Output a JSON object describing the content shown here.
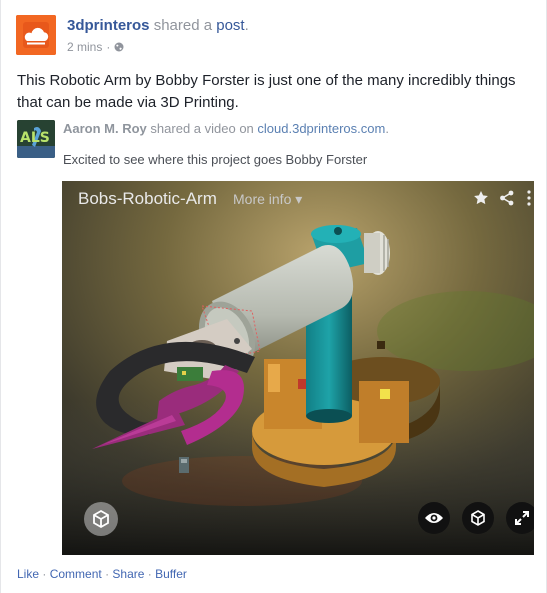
{
  "header": {
    "page_name": "3dprinteros",
    "shared_text": "shared a",
    "post_link": "post",
    "period": ".",
    "time": "2 mins",
    "separator": "·",
    "globe_icon": "globe-icon"
  },
  "post": {
    "text": "This Robotic Arm by Bobby Forster is just one of the many incredibly things that can be made via 3D Printing."
  },
  "shared_video": {
    "author": "Aaron M. Roy",
    "shared_text": "shared a video on",
    "link": "cloud.3dprinteros.com",
    "period": ".",
    "caption": "Excited to see where this project goes Bobby Forster",
    "avatar_text": "ALS"
  },
  "video": {
    "title": "Bobs-Robotic-Arm",
    "more_info": "More info",
    "icons": [
      "star-icon",
      "share-icon",
      "eye-icon",
      "cube-icon",
      "fullscreen-icon",
      "sketchfab-icon"
    ]
  },
  "actions": {
    "like": "Like",
    "comment": "Comment",
    "share": "Share",
    "buffer": "Buffer",
    "dot": "·"
  },
  "colors": {
    "brand_orange": "#f26722",
    "link_blue": "#365899",
    "meta_gray": "#90949c"
  }
}
